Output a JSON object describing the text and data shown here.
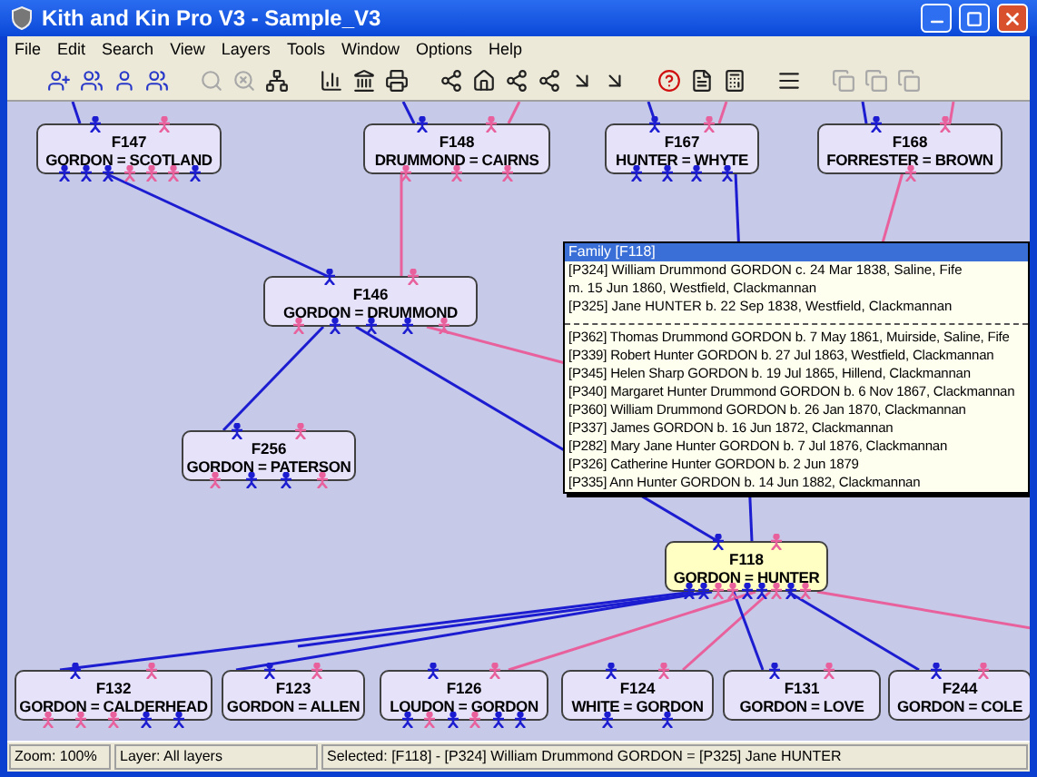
{
  "window": {
    "title": "Kith and Kin Pro V3 - Sample_V3"
  },
  "menu": [
    "File",
    "Edit",
    "Search",
    "View",
    "Layers",
    "Tools",
    "Window",
    "Options",
    "Help"
  ],
  "toolbar": [
    {
      "kind": "add-man",
      "disabled": false
    },
    {
      "kind": "add-couple",
      "disabled": false
    },
    {
      "kind": "person",
      "disabled": false
    },
    {
      "kind": "family",
      "disabled": false
    },
    {
      "kind": "search",
      "disabled": true
    },
    {
      "kind": "find",
      "disabled": true
    },
    {
      "kind": "tree",
      "disabled": false
    },
    {
      "kind": "chart",
      "disabled": false
    },
    {
      "kind": "bank",
      "disabled": false
    },
    {
      "kind": "print",
      "disabled": false
    },
    {
      "kind": "link",
      "disabled": false
    },
    {
      "kind": "home",
      "disabled": false
    },
    {
      "kind": "link",
      "disabled": false
    },
    {
      "kind": "link",
      "disabled": false
    },
    {
      "kind": "arrow",
      "disabled": false
    },
    {
      "kind": "arrow",
      "disabled": false
    },
    {
      "kind": "help",
      "disabled": false
    },
    {
      "kind": "doc",
      "disabled": false
    },
    {
      "kind": "calc",
      "disabled": false
    },
    {
      "kind": "list",
      "disabled": false
    },
    {
      "kind": "copy",
      "disabled": true
    },
    {
      "kind": "copy",
      "disabled": true
    },
    {
      "kind": "copy",
      "disabled": true
    }
  ],
  "families": [
    {
      "id": "F147",
      "names": "GORDON = SCOTLAND",
      "selected": false,
      "top": [
        {
          "kind": "male"
        },
        {
          "kind": "female"
        }
      ],
      "bottom": [
        {
          "kind": "male"
        },
        {
          "kind": "male"
        },
        {
          "kind": "male"
        },
        {
          "kind": "female"
        },
        {
          "kind": "female"
        },
        {
          "kind": "female"
        },
        {
          "kind": "male"
        }
      ]
    },
    {
      "id": "F148",
      "names": "DRUMMOND = CAIRNS",
      "selected": false,
      "top": [
        {
          "kind": "male"
        },
        {
          "kind": "female"
        }
      ],
      "bottom": [
        {
          "kind": "female"
        },
        {
          "kind": "female"
        },
        {
          "kind": "female"
        }
      ]
    },
    {
      "id": "F167",
      "names": "HUNTER = WHYTE",
      "selected": false,
      "top": [
        {
          "kind": "male"
        },
        {
          "kind": "female"
        }
      ],
      "bottom": [
        {
          "kind": "male"
        },
        {
          "kind": "male"
        },
        {
          "kind": "male"
        },
        {
          "kind": "male"
        }
      ]
    },
    {
      "id": "F168",
      "names": "FORRESTER = BROWN",
      "selected": false,
      "top": [
        {
          "kind": "male"
        },
        {
          "kind": "female"
        }
      ],
      "bottom": [
        {
          "kind": "female"
        }
      ]
    },
    {
      "id": "F146",
      "names": "GORDON = DRUMMOND",
      "selected": false,
      "top": [
        {
          "kind": "male"
        },
        {
          "kind": "female"
        }
      ],
      "bottom": [
        {
          "kind": "female"
        },
        {
          "kind": "male"
        },
        {
          "kind": "male"
        },
        {
          "kind": "male"
        },
        {
          "kind": "female"
        }
      ]
    },
    {
      "id": "F256",
      "names": "GORDON = PATERSON",
      "selected": false,
      "top": [
        {
          "kind": "male"
        },
        {
          "kind": "female"
        }
      ],
      "bottom": [
        {
          "kind": "female"
        },
        {
          "kind": "male"
        },
        {
          "kind": "male"
        },
        {
          "kind": "female"
        }
      ]
    },
    {
      "id": "F118",
      "names": "GORDON = HUNTER",
      "selected": true,
      "top": [
        {
          "kind": "male"
        },
        {
          "kind": "female"
        }
      ],
      "bottom": [
        {
          "kind": "male"
        },
        {
          "kind": "male"
        },
        {
          "kind": "female"
        },
        {
          "kind": "female"
        },
        {
          "kind": "male"
        },
        {
          "kind": "male"
        },
        {
          "kind": "female"
        },
        {
          "kind": "male"
        },
        {
          "kind": "female"
        }
      ]
    },
    {
      "id": "F132",
      "names": "GORDON = CALDERHEAD",
      "selected": false,
      "top": [
        {
          "kind": "male"
        },
        {
          "kind": "female"
        }
      ],
      "bottom": [
        {
          "kind": "female"
        },
        {
          "kind": "female"
        },
        {
          "kind": "female"
        },
        {
          "kind": "male"
        },
        {
          "kind": "male"
        }
      ]
    },
    {
      "id": "F123",
      "names": "GORDON = ALLEN",
      "selected": false,
      "top": [
        {
          "kind": "male"
        },
        {
          "kind": "female"
        }
      ]
    },
    {
      "id": "F126",
      "names": "LOUDON = GORDON",
      "selected": false,
      "top": [
        {
          "kind": "male"
        },
        {
          "kind": "female"
        }
      ],
      "bottom": [
        {
          "kind": "male"
        },
        {
          "kind": "female"
        },
        {
          "kind": "male"
        },
        {
          "kind": "female"
        },
        {
          "kind": "male"
        },
        {
          "kind": "male"
        }
      ]
    },
    {
      "id": "F124",
      "names": "WHITE = GORDON",
      "selected": false,
      "top": [
        {
          "kind": "male"
        },
        {
          "kind": "female"
        }
      ],
      "bottom": [
        {
          "kind": "male"
        },
        {
          "kind": "male"
        }
      ]
    },
    {
      "id": "F131",
      "names": "GORDON = LOVE",
      "selected": false,
      "top": [
        {
          "kind": "male"
        },
        {
          "kind": "female"
        }
      ]
    },
    {
      "id": "F244",
      "names": "GORDON = COLE",
      "selected": false,
      "top": [
        {
          "kind": "male"
        },
        {
          "kind": "female"
        }
      ]
    }
  ],
  "popup": {
    "title": "Family [F118]",
    "parents": [
      "[P324] William Drummond GORDON c. 24 Mar 1838, Saline, Fife",
      "m. 15 Jun 1860, Westfield, Clackmannan",
      "[P325] Jane HUNTER b. 22 Sep 1838, Westfield, Clackmannan"
    ],
    "children": [
      "[P362] Thomas Drummond GORDON b. 7 May 1861, Muirside, Saline, Fife",
      "[P339] Robert Hunter GORDON b. 27 Jul 1863, Westfield, Clackmannan",
      "[P345] Helen Sharp GORDON b. 19 Jul 1865, Hillend, Clackmannan",
      "[P340] Margaret Hunter Drummond GORDON b. 6 Nov 1867, Clackmannan",
      "[P360] William Drummond GORDON b. 26 Jan 1870, Clackmannan",
      "[P337] James GORDON b. 16 Jun 1872, Clackmannan",
      "[P282] Mary Jane Hunter GORDON b. 7 Jul 1876, Clackmannan",
      "[P326] Catherine Hunter GORDON b. 2 Jun 1879",
      "[P335] Ann Hunter GORDON b. 14 Jun 1882, Clackmannan"
    ]
  },
  "status_bar": [
    "Zoom: 100%",
    "Layer: All layers",
    "Selected: [F118] - [P324] William Drummond GORDON = [P325] Jane HUNTER"
  ]
}
